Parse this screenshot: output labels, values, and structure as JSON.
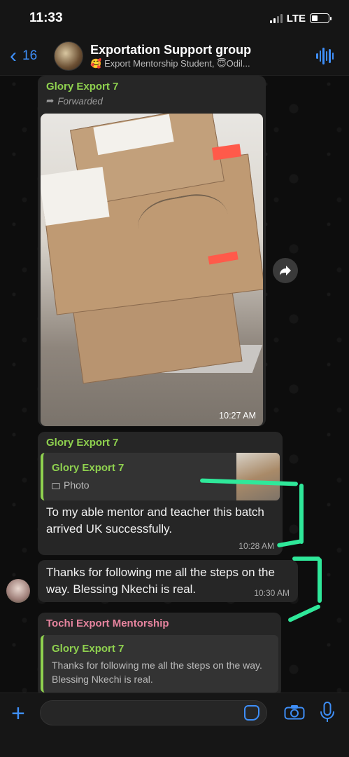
{
  "status_bar": {
    "time": "11:33",
    "network": "LTE"
  },
  "header": {
    "back_count": "16",
    "title": "Exportation Support group",
    "subtitle": "🥰 Export Mentorship Student, 😇Odil..."
  },
  "messages": [
    {
      "sender": "Glory Export 7",
      "forwarded_label": "Forwarded",
      "type": "photo",
      "time": "10:27 AM"
    },
    {
      "sender": "Glory Export 7",
      "quote": {
        "sender": "Glory Export 7",
        "text": "Photo"
      },
      "text": "To my able mentor and teacher this batch arrived UK successfully.",
      "time": "10:28 AM"
    },
    {
      "text": "Thanks for following me all the steps on the way. Blessing Nkechi is real.",
      "time": "10:30 AM"
    },
    {
      "sender": "Tochi Export Mentorship",
      "quote": {
        "sender": "Glory Export 7",
        "text": "Thanks for following me all the steps on the way. Blessing Nkechi is real."
      }
    }
  ],
  "input": {
    "placeholder": ""
  },
  "colors": {
    "accent": "#3e8ef7",
    "sender_green": "#8fd14f",
    "sender_pink": "#e7849f",
    "annotation": "#2fe89a"
  }
}
